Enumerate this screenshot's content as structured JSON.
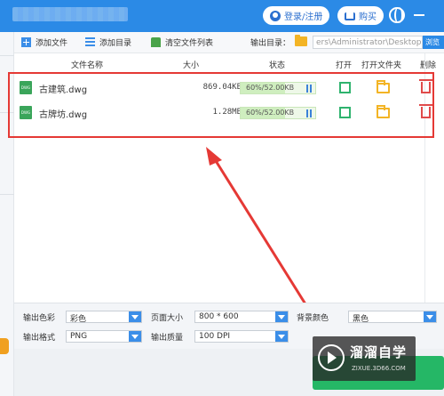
{
  "header": {
    "login_label": "登录/注册",
    "buy_label": "购买",
    "colors": {
      "titlebar": "#2b8ae6",
      "accent": "#2b6fcf"
    }
  },
  "toolbar": {
    "add_file_label": "添加文件",
    "add_folder_label": "添加目录",
    "clear_list_label": "清空文件列表",
    "output_dir_label": "输出目录：",
    "output_dir_value": "ers\\Administrator\\Desktop",
    "browse_label": "浏览"
  },
  "table": {
    "headers": {
      "name": "文件名称",
      "size": "大小",
      "status": "状态",
      "open": "打开",
      "open_folder": "打开文件夹",
      "delete": "删除"
    },
    "rows": [
      {
        "icon": "dwg-file-icon",
        "name": "古建筑.dwg",
        "size": "869.04KB",
        "status": "60%/52.00KB",
        "progress": 0.6
      },
      {
        "icon": "dwg-file-icon",
        "name": "古牌坊.dwg",
        "size": "1.28MB",
        "status": "60%/52.00KB",
        "progress": 0.6
      }
    ]
  },
  "settings": {
    "output_color_label": "输出色彩",
    "output_color_value": "彩色",
    "page_size_label": "页面大小",
    "page_size_value": "800 * 600",
    "background_label": "背景颜色",
    "background_value": "黑色",
    "output_format_label": "输出格式",
    "output_format_value": "PNG",
    "output_quality_label": "输出质量",
    "output_quality_value": "100 DPI"
  },
  "watermark": {
    "title": "溜溜自学",
    "subtitle": "ZIXUE.3D66.COM"
  },
  "annotation": {
    "highlight_color": "#e53935"
  }
}
